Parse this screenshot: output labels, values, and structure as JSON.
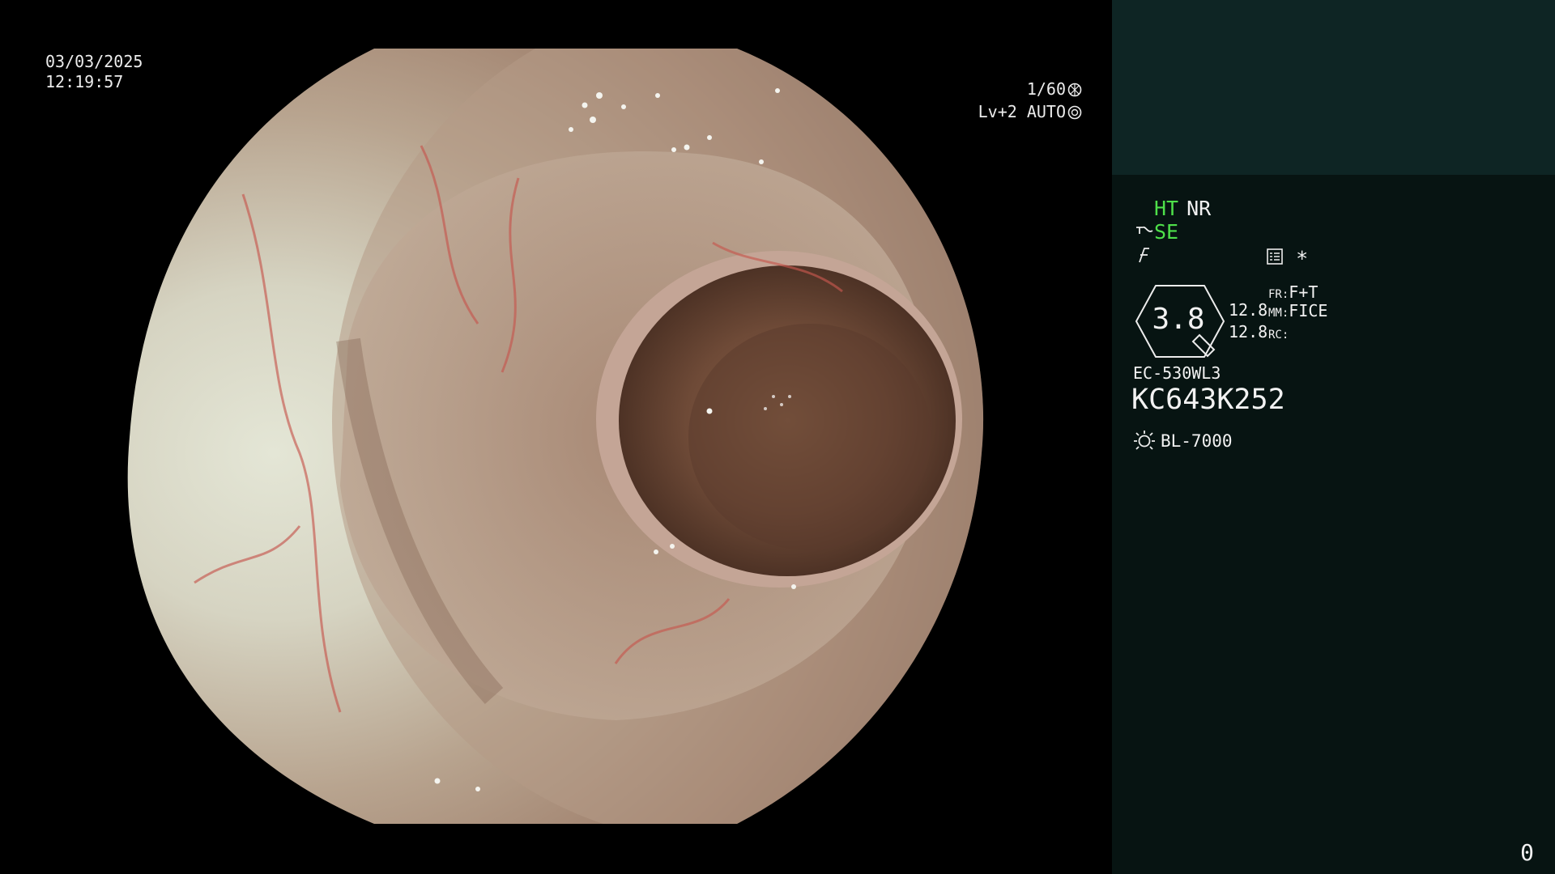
{
  "osd": {
    "date": "03/03/2025",
    "time": "12:19:57",
    "shutter": "1/60",
    "shutter_icon": "aperture-icon",
    "level": "Lv+2 AUTO",
    "level_icon": "auto-exposure-icon"
  },
  "panel": {
    "ht": "HT",
    "nr": "NR",
    "se": "SE",
    "se_icon": "structure-enhance-icon",
    "f_icon": "color-tone-icon",
    "menu_icon": "menu-list-icon",
    "star": "*",
    "iris": "3.8",
    "gain_a": "12.8",
    "gain_b": "12.8",
    "fr_label": "FR:",
    "fr_value": "F+T",
    "mm_label": "MM:",
    "mm_value": "FICE",
    "rc_label": "RC:",
    "scope_model": "EC-530WL3",
    "serial": "KC643K252",
    "light_icon": "light-source-icon",
    "light_source": "BL-7000",
    "corner_number": "0"
  },
  "colors": {
    "accent_green": "#4ee04a",
    "panel_bg": "#071412",
    "panel_top_bg": "#0e2524",
    "text": "#f2f2f2"
  }
}
